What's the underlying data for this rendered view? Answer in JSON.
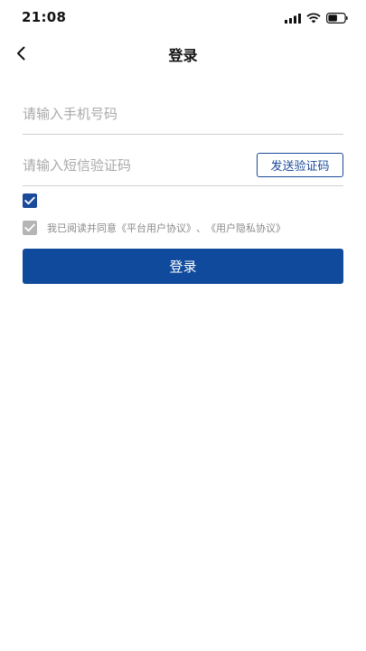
{
  "status_bar": {
    "time": "21:08",
    "icons": [
      "signal-icon",
      "wifi-icon",
      "battery-icon"
    ]
  },
  "nav": {
    "back_icon": "chevron-left-icon",
    "title": "登录"
  },
  "form": {
    "phone_placeholder": "请输入手机号码",
    "phone_value": "",
    "code_placeholder": "请输入短信验证码",
    "code_value": "",
    "send_code_label": "发送验证码",
    "checkbox_checked": true
  },
  "agreement": {
    "checked": true,
    "prefix": "我已阅读并同意",
    "platform_link": "《平台用户协议》",
    "separator": "、",
    "privacy_link": "《用户隐私协议》"
  },
  "login_button_label": "登录",
  "colors": {
    "primary": "#0f4a9c",
    "accent_border": "#1b4a9a",
    "disabled_check": "#b5b5b5",
    "placeholder": "#a9a9a9",
    "divider": "#cfcfcf"
  }
}
